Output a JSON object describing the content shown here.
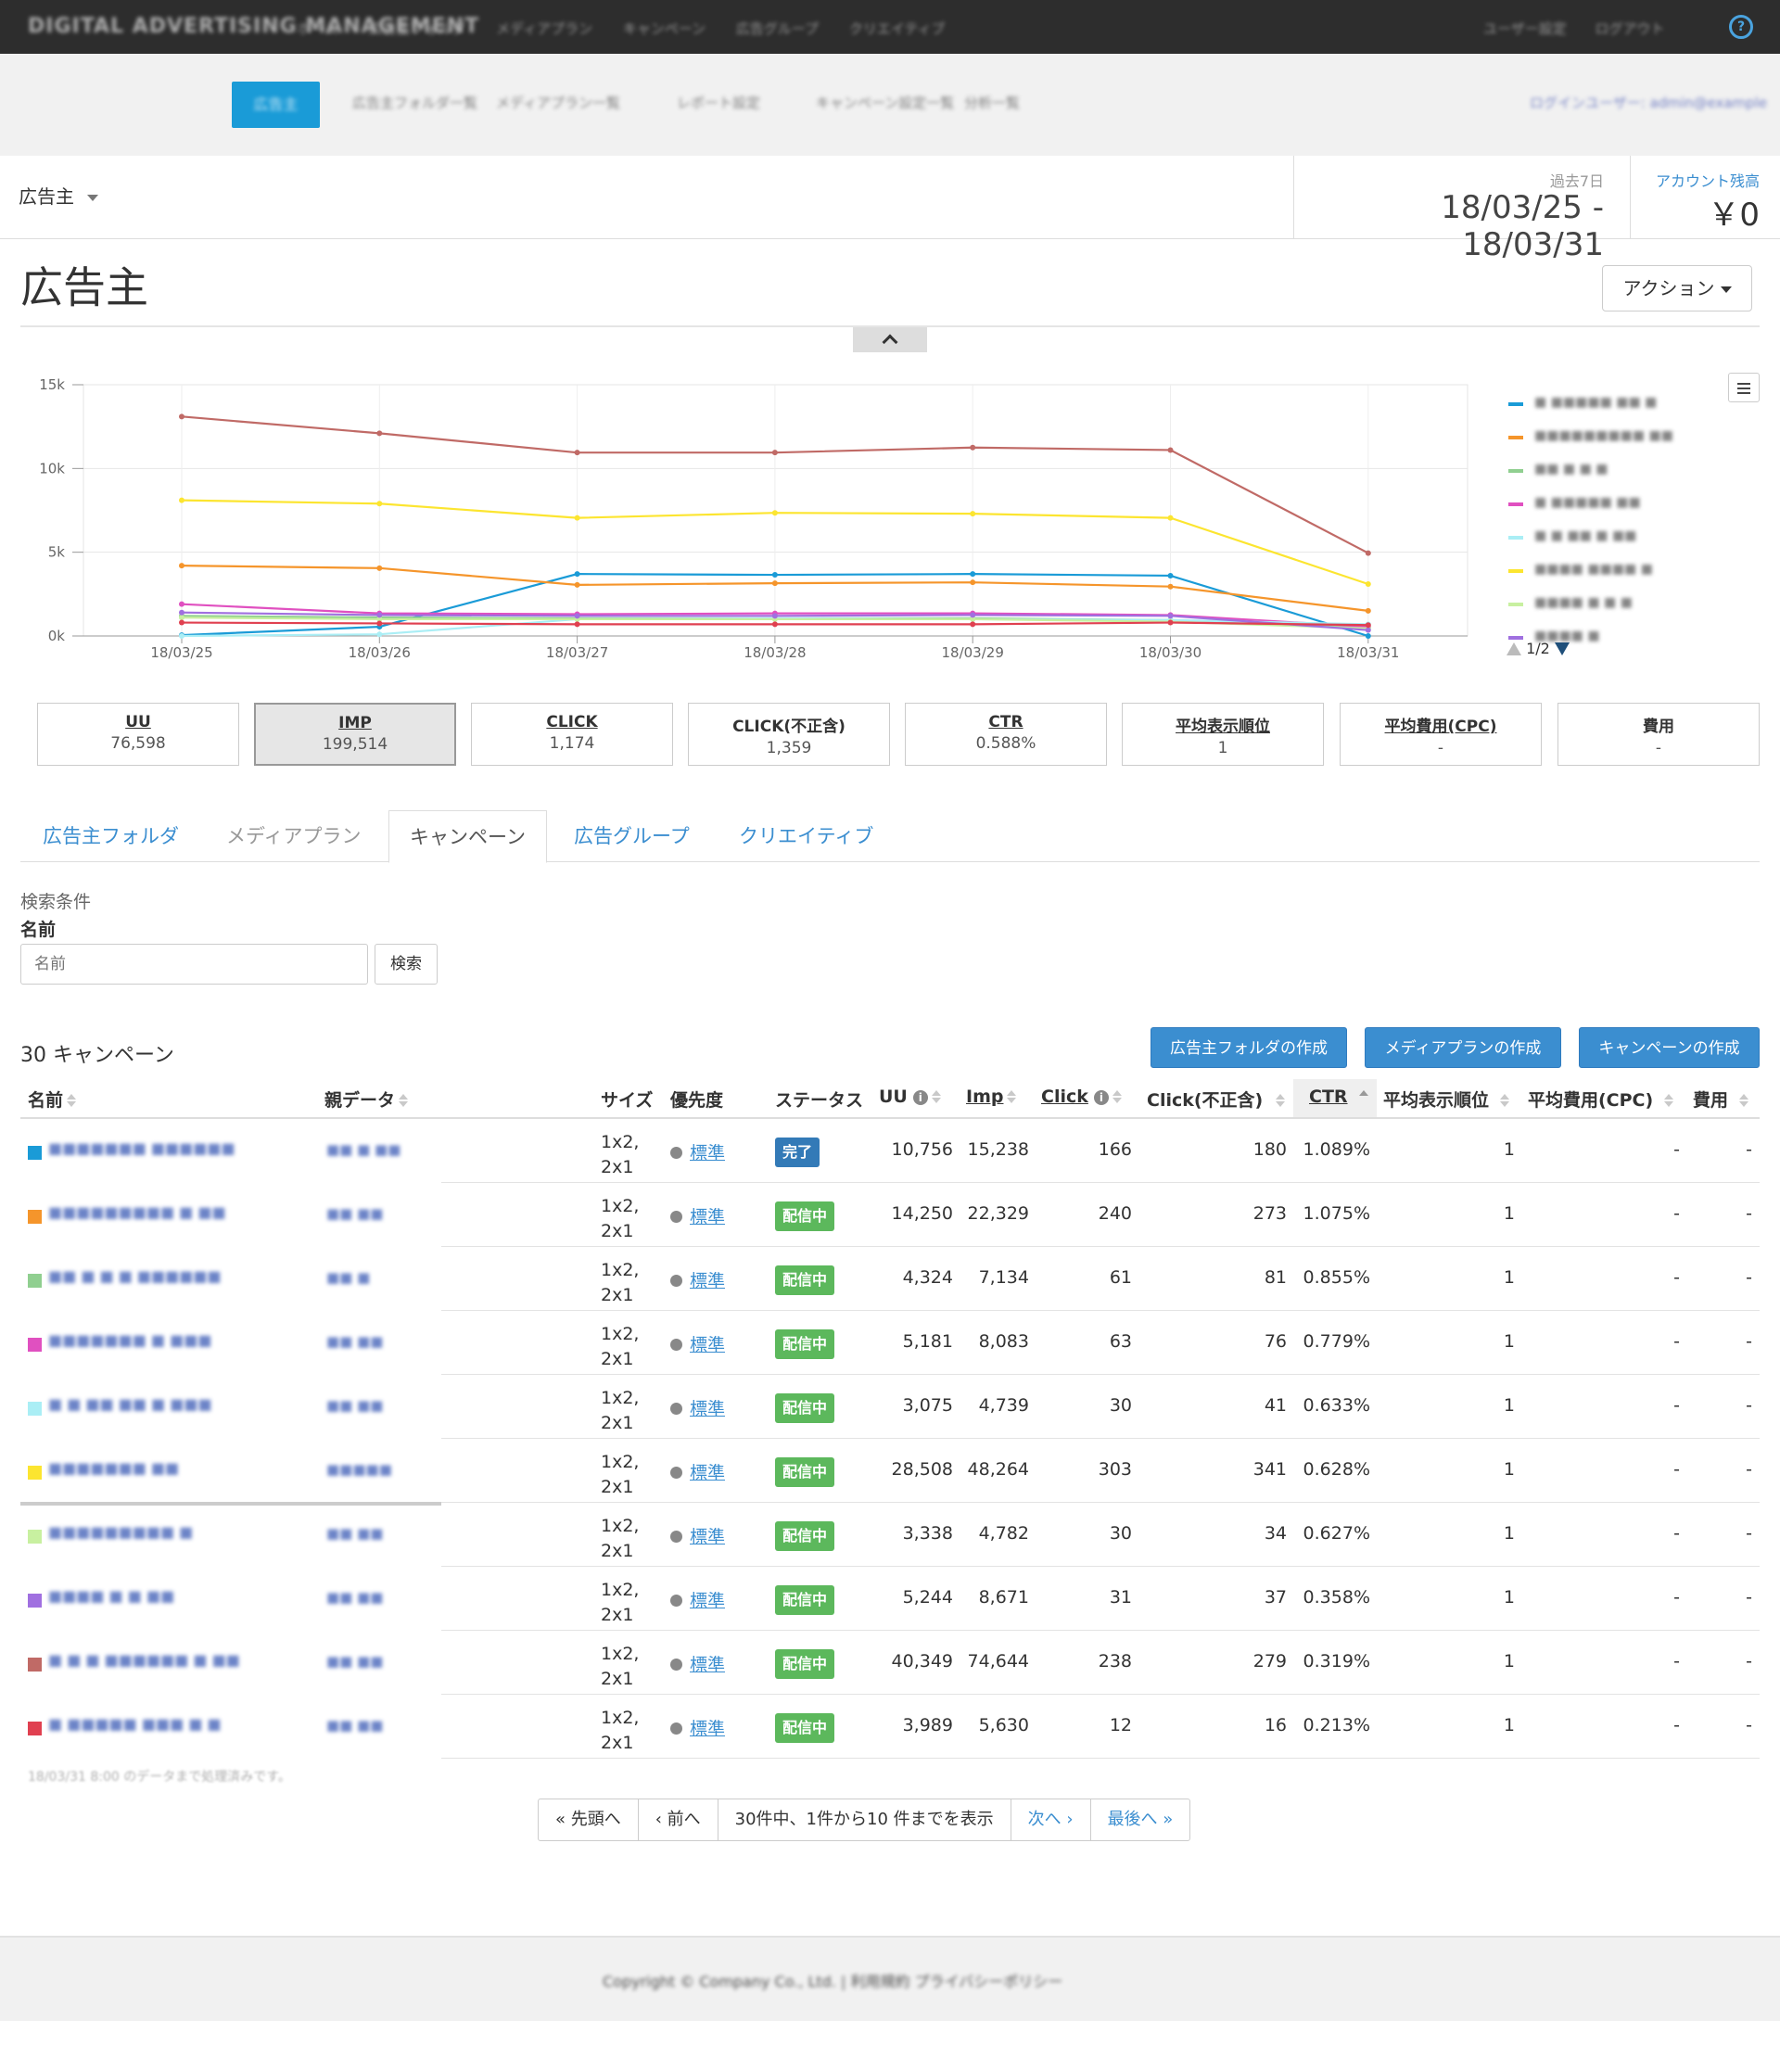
{
  "topbar": {
    "brand": "DIGITAL ADVERTISING MANAGEMENT",
    "nav": [
      "ホーム",
      "広告主フォルダ",
      "メディアプラン",
      "キャンペーン",
      "広告グループ",
      "クリエイティブ"
    ],
    "right": [
      "ユーザー設定",
      "ログアウト"
    ],
    "help_glyph": "?"
  },
  "subnav": {
    "active": "広告主",
    "items": [
      "広告主フォルダ一覧",
      "メディアプラン一覧",
      "レポート設定",
      "キャンペーン設定一覧",
      "分析一覧"
    ],
    "right": "ログインユーザー: admin@example"
  },
  "header": {
    "advertiser_select": "広告主",
    "period_label": "過去7日",
    "date_range": "18/03/25 - 18/03/31",
    "balance_label": "アカウント残高",
    "balance": "￥0"
  },
  "page": {
    "title": "広告主",
    "action_button": "アクション"
  },
  "chart_data": {
    "type": "line",
    "x": [
      "18/03/25",
      "18/03/26",
      "18/03/27",
      "18/03/28",
      "18/03/29",
      "18/03/30",
      "18/03/31"
    ],
    "yticks": [
      "15k",
      "10k",
      "5k",
      "0k"
    ],
    "ylim": [
      0,
      15000
    ],
    "grid": true,
    "legend_position": "right",
    "legend_page": "1/2",
    "series": [
      {
        "color": "#1a9bd7",
        "values": [
          50,
          550,
          3700,
          3650,
          3700,
          3600,
          0
        ]
      },
      {
        "color": "#f5952b",
        "values": [
          4200,
          4050,
          3050,
          3150,
          3200,
          2950,
          1500
        ]
      },
      {
        "color": "#90cf90",
        "values": [
          1200,
          1100,
          1050,
          1050,
          1050,
          950,
          500
        ]
      },
      {
        "color": "#e050c0",
        "values": [
          1900,
          1350,
          1300,
          1350,
          1350,
          1250,
          550
        ]
      },
      {
        "color": "#aaeef5",
        "values": [
          0,
          100,
          1000,
          1050,
          1000,
          950,
          700
        ]
      },
      {
        "color": "#fce530",
        "values": [
          8100,
          7900,
          7050,
          7350,
          7300,
          7050,
          3100
        ]
      },
      {
        "color": "#c8f0a0",
        "values": [
          1100,
          1000,
          1000,
          1000,
          1000,
          850,
          450
        ]
      },
      {
        "color": "#a070e0",
        "values": [
          1400,
          1250,
          1200,
          1200,
          1250,
          1200,
          350
        ]
      },
      {
        "color": "#c06a66",
        "values": [
          13100,
          12100,
          10950,
          10950,
          11250,
          11100,
          4950
        ]
      },
      {
        "color": "#e04050",
        "values": [
          800,
          750,
          700,
          700,
          700,
          800,
          650
        ]
      }
    ]
  },
  "legend": {
    "items": [
      {
        "color": "#1a9bd7",
        "text": "■ ■■■■■ ■■ ■"
      },
      {
        "color": "#f5952b",
        "text": "■■■■■■■■■ ■■"
      },
      {
        "color": "#90cf90",
        "text": "  ■■   ■ ■ ■"
      },
      {
        "color": "#e050c0",
        "text": " ■ ■■■■■ ■■"
      },
      {
        "color": "#aaeef5",
        "text": " ■ ■ ■■ ■ ■■"
      },
      {
        "color": "#fce530",
        "text": "■■■■ ■■■■ ■"
      },
      {
        "color": "#c8f0a0",
        "text": " ■■■■ ■ ■ ■"
      },
      {
        "color": "#a070e0",
        "text": "   ■■■■ ■"
      }
    ]
  },
  "kpis": [
    {
      "label": "UU",
      "value": "76,598"
    },
    {
      "label": "IMP",
      "value": "199,514"
    },
    {
      "label": "CLICK",
      "value": "1,174"
    },
    {
      "label": "CLICK(不正含)",
      "value": "1,359"
    },
    {
      "label": "CTR",
      "value": "0.588%"
    },
    {
      "label": "平均表示順位",
      "value": "1"
    },
    {
      "label": "平均費用(CPC)",
      "value": "-"
    },
    {
      "label": "費用",
      "value": "-"
    }
  ],
  "tabs": [
    "広告主フォルダ",
    "メディアプラン",
    "キャンペーン",
    "広告グループ",
    "クリエイティブ"
  ],
  "search": {
    "conditions_label": "検索条件",
    "name_label": "名前",
    "placeholder": "名前",
    "button": "検索"
  },
  "list": {
    "count_title": "30 キャンペーン",
    "buttons": [
      "広告主フォルダの作成",
      "メディアプランの作成",
      "キャンペーンの作成"
    ],
    "columns": [
      "名前",
      "親データ",
      "サイズ",
      "優先度",
      "ステータス",
      "UU",
      "Imp",
      "Click",
      "Click(不正含)",
      "CTR",
      "平均表示順位",
      "平均費用(CPC)",
      "費用"
    ],
    "rows": [
      {
        "color": "#1a9bd7",
        "name": "■■■■■■■ ■■■■■■",
        "parent": "■■ ■ ■■",
        "size": "1x2,\n2x1",
        "priority": "標準",
        "status": "完了",
        "status_color": "#337ab7",
        "uu": "10,756",
        "imp": "15,238",
        "click": "166",
        "click_all": "180",
        "ctr": "1.089%",
        "rank": "1",
        "cpc": "-",
        "cost": "-"
      },
      {
        "color": "#f5952b",
        "name": "■■■■■■■■■ ■ ■■",
        "parent": "■■ ■■",
        "size": "1x2,\n2x1",
        "priority": "標準",
        "status": "配信中",
        "status_color": "#5cb85c",
        "uu": "14,250",
        "imp": "22,329",
        "click": "240",
        "click_all": "273",
        "ctr": "1.075%",
        "rank": "1",
        "cpc": "-",
        "cost": "-"
      },
      {
        "color": "#90cf90",
        "name": "■■ ■  ■   ■ ■■■■■■",
        "parent": "■■ ■",
        "size": "1x2,\n2x1",
        "priority": "標準",
        "status": "配信中",
        "status_color": "#5cb85c",
        "uu": "4,324",
        "imp": "7,134",
        "click": "61",
        "click_all": "81",
        "ctr": "0.855%",
        "rank": "1",
        "cpc": "-",
        "cost": "-"
      },
      {
        "color": "#e050c0",
        "name": "■■■■■■■ ■ ■■■",
        "parent": "■■ ■■",
        "size": "1x2,\n2x1",
        "priority": "標準",
        "status": "配信中",
        "status_color": "#5cb85c",
        "uu": "5,181",
        "imp": "8,083",
        "click": "63",
        "click_all": "76",
        "ctr": "0.779%",
        "rank": "1",
        "cpc": "-",
        "cost": "-"
      },
      {
        "color": "#aaeef5",
        "name": "■ ■  ■■  ■■ ■ ■■■",
        "parent": "■■ ■■",
        "size": "1x2,\n2x1",
        "priority": "標準",
        "status": "配信中",
        "status_color": "#5cb85c",
        "uu": "3,075",
        "imp": "4,739",
        "click": "30",
        "click_all": "41",
        "ctr": "0.633%",
        "rank": "1",
        "cpc": "-",
        "cost": "-"
      },
      {
        "color": "#fce530",
        "name": "■■■■■■■ ■■",
        "parent": "■■■■■",
        "size": "1x2,\n2x1",
        "priority": "標準",
        "status": "配信中",
        "status_color": "#5cb85c",
        "uu": "28,508",
        "imp": "48,264",
        "click": "303",
        "click_all": "341",
        "ctr": "0.628%",
        "rank": "1",
        "cpc": "-",
        "cost": "-"
      },
      {
        "color": "#c8f0a0",
        "name": "■■■■■■■■■ ■",
        "parent": "■■ ■■",
        "size": "1x2,\n2x1",
        "priority": "標準",
        "status": "配信中",
        "status_color": "#5cb85c",
        "uu": "3,338",
        "imp": "4,782",
        "click": "30",
        "click_all": "34",
        "ctr": "0.627%",
        "rank": "1",
        "cpc": "-",
        "cost": "-"
      },
      {
        "color": "#a070e0",
        "name": "■■■■  ■ ■  ■■",
        "parent": "■■ ■■",
        "size": "1x2,\n2x1",
        "priority": "標準",
        "status": "配信中",
        "status_color": "#5cb85c",
        "uu": "5,244",
        "imp": "8,671",
        "click": "31",
        "click_all": "37",
        "ctr": "0.358%",
        "rank": "1",
        "cpc": "-",
        "cost": "-"
      },
      {
        "color": "#c06a66",
        "name": "■ ■ ■  ■■■■■■ ■ ■■",
        "parent": "■■ ■■",
        "size": "1x2,\n2x1",
        "priority": "標準",
        "status": "配信中",
        "status_color": "#5cb85c",
        "uu": "40,349",
        "imp": "74,644",
        "click": "238",
        "click_all": "279",
        "ctr": "0.319%",
        "rank": "1",
        "cpc": "-",
        "cost": "-"
      },
      {
        "color": "#e04050",
        "name": "■ ■■■■■ ■■■ ■ ■",
        "parent": "■■ ■■",
        "size": "1x2,\n2x1",
        "priority": "標準",
        "status": "配信中",
        "status_color": "#5cb85c",
        "uu": "3,989",
        "imp": "5,630",
        "click": "12",
        "click_all": "16",
        "ctr": "0.213%",
        "rank": "1",
        "cpc": "-",
        "cost": "-"
      }
    ],
    "note": "18/03/31 8:00 のデータまで処理済みです。"
  },
  "pagination": {
    "first": "« 先頭へ",
    "prev": "‹ 前へ",
    "info": "30件中、1件から10 件までを表示",
    "next": "次へ ›",
    "last": "最後へ »"
  },
  "footer": {
    "text": "Copyright © Company Co., Ltd. | 利用規約  プライバシーポリシー"
  }
}
